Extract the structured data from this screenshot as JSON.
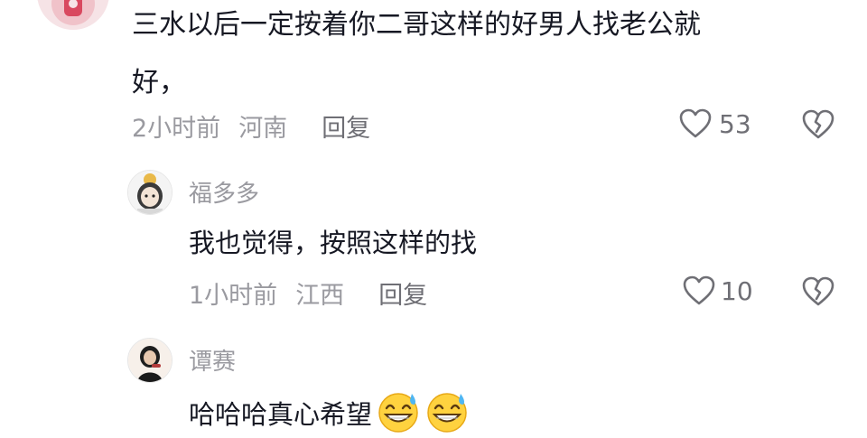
{
  "comment": {
    "text_line1": "三水以后一定按着你二哥这样的好男人找老公就",
    "text_line2": "好，",
    "time": "2小时前",
    "location": "河南",
    "reply_label": "回复",
    "like_count": "53",
    "avatar_icon": "user-avatar-icon"
  },
  "replies": [
    {
      "nickname": "福多多",
      "text": "我也觉得，按照这样的找",
      "time": "1小时前",
      "location": "江西",
      "reply_label": "回复",
      "like_count": "10",
      "avatar_icon": "user-avatar-icon"
    },
    {
      "nickname": "谭赛",
      "text": "哈哈哈真心希望",
      "emojis": [
        "grinning-sweat-emoji",
        "grinning-sweat-emoji"
      ],
      "avatar_icon": "user-avatar-icon"
    }
  ],
  "icons": {
    "like": "heart-outline-icon",
    "dislike": "broken-heart-icon"
  },
  "colors": {
    "text": "#161823",
    "meta": "#9a9aa0",
    "reply": "#6f6f75",
    "background": "#ffffff"
  }
}
